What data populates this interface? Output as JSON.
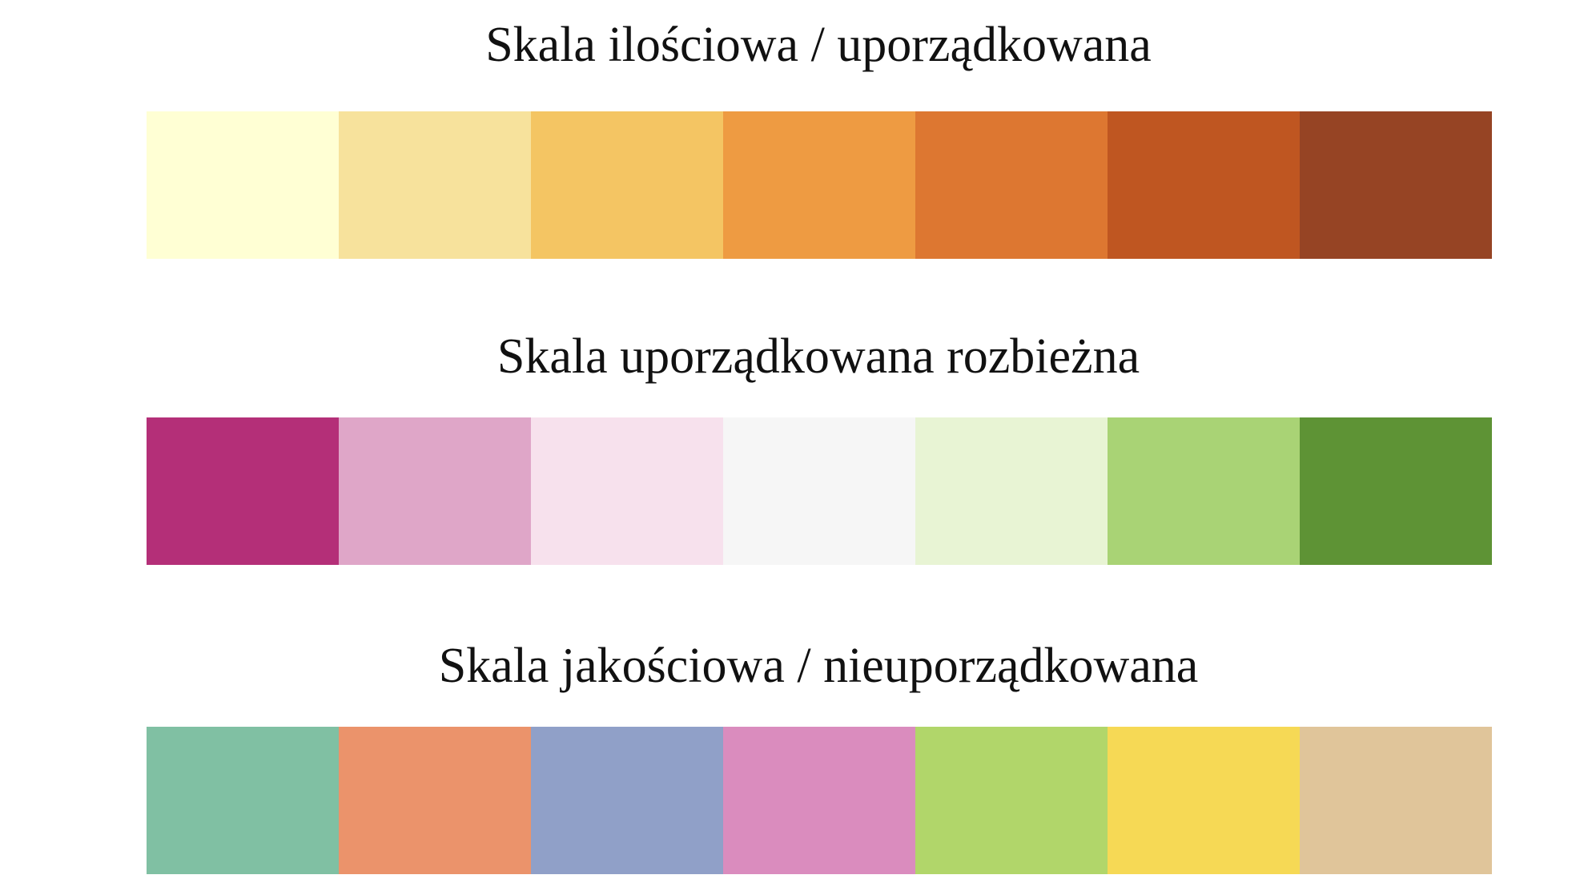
{
  "palettes": [
    {
      "title": "Skala ilościowa / uporządkowana",
      "colors": [
        "#FFFFD4",
        "#F7E29C",
        "#F4C563",
        "#EE9B42",
        "#DD7731",
        "#BF5621",
        "#964424"
      ]
    },
    {
      "title": "Skala uporządkowana rozbieżna",
      "colors": [
        "#B42F78",
        "#DFA6C8",
        "#F7E1ED",
        "#F6F6F6",
        "#E8F4D4",
        "#A9D375",
        "#5E9335"
      ]
    },
    {
      "title": "Skala jakościowa / nieuporządkowana",
      "colors": [
        "#80C0A3",
        "#EB936B",
        "#90A0C8",
        "#DA8CBE",
        "#B1D66A",
        "#F6D955",
        "#E0C59A"
      ]
    }
  ]
}
